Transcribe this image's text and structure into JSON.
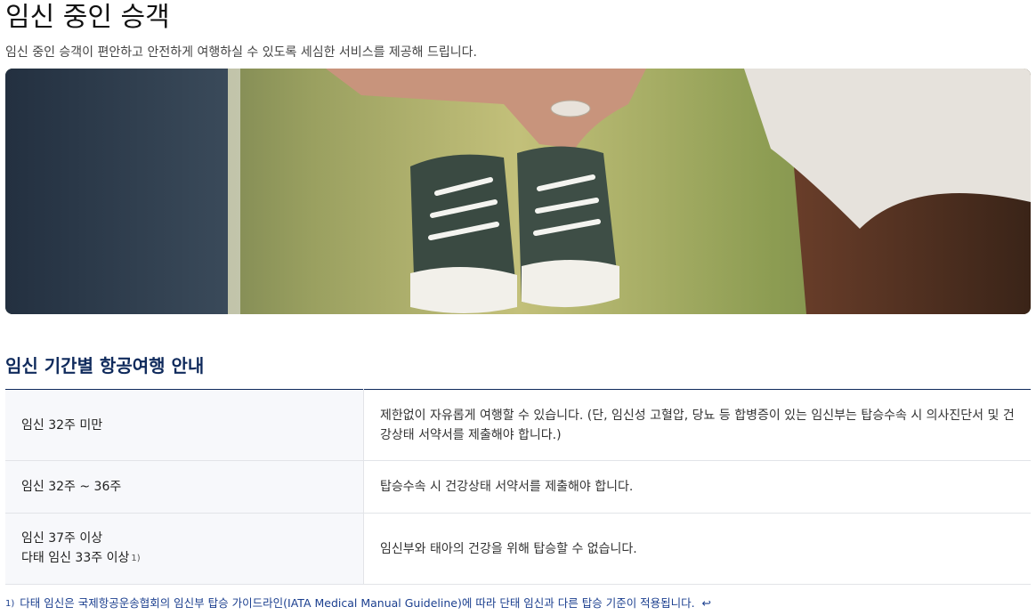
{
  "page": {
    "title": "임신 중인 승객",
    "subtitle": "임신 중인 승객이 편안하고 안전하게 여행하실 수 있도록 세심한 서비스를 제공해 드립니다."
  },
  "hero": {
    "icon": "hero-photo-baby-shoes"
  },
  "section": {
    "title": "임신 기간별 항공여행 안내"
  },
  "table": {
    "rows": [
      {
        "label_line1": "임신 32주 미만",
        "label_line2": "",
        "footnote_ref": "",
        "description": "제한없이 자유롭게 여행할 수 있습니다. (단, 임신성 고혈압, 당뇨 등 합병증이 있는 임신부는 탑승수속 시 의사진단서 및 건강상태 서약서를 제출해야 합니다.)"
      },
      {
        "label_line1": "임신 32주 ~ 36주",
        "label_line2": "",
        "footnote_ref": "",
        "description": "탑승수속 시 건강상태 서약서를 제출해야 합니다."
      },
      {
        "label_line1": "임신 37주 이상",
        "label_line2": "다태 임신 33주 이상",
        "footnote_ref": "1)",
        "description": "임신부와 태아의 건강을 위해 탑승할 수 없습니다."
      }
    ]
  },
  "footnote": {
    "number": "1)",
    "text": "다태 임신은 국제항공운송협회의 임신부 탑승 가이드라인(IATA Medical Manual Guideline)에 따라 단태 임신과 다른 탑승 기준이 적용됩니다.",
    "return_symbol": "↩"
  },
  "colors": {
    "section_title": "#0f2a5c",
    "footnote": "#1b3f8f",
    "label_bg": "#f7f8fb"
  }
}
